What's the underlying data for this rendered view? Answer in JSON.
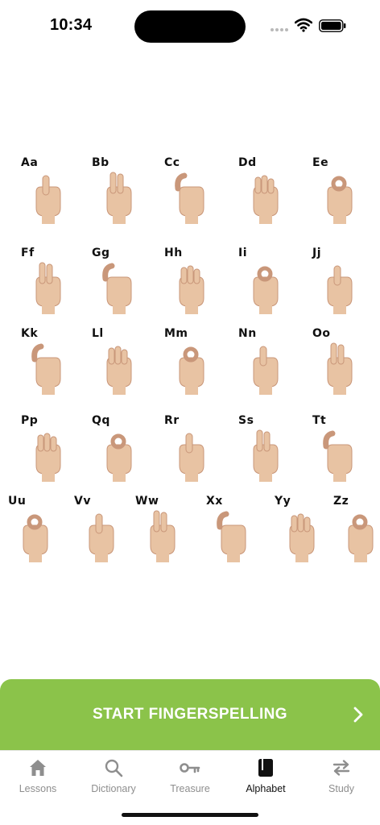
{
  "status_bar": {
    "time": "10:34"
  },
  "alphabet": {
    "rows": [
      {
        "letters": [
          "Aa",
          "Bb",
          "Cc",
          "Dd",
          "Ee"
        ]
      },
      {
        "letters": [
          "Ff",
          "Gg",
          "Hh",
          "Ii",
          "Jj"
        ]
      },
      {
        "letters": [
          "Kk",
          "Ll",
          "Mm",
          "Nn",
          "Oo"
        ]
      },
      {
        "letters": [
          "Pp",
          "Qq",
          "Rr",
          "Ss",
          "Tt"
        ]
      },
      {
        "letters": [
          "Uu",
          "Vv",
          "Ww",
          "Xx",
          "Yy",
          "Zz"
        ]
      }
    ]
  },
  "cta": {
    "label": "START FINGERSPELLING",
    "icon": "chevron-right-icon",
    "color": "#8bc34a"
  },
  "tabs": [
    {
      "label": "Lessons",
      "icon": "home-icon",
      "active": false
    },
    {
      "label": "Dictionary",
      "icon": "search-icon",
      "active": false
    },
    {
      "label": "Treasure",
      "icon": "key-icon",
      "active": false
    },
    {
      "label": "Alphabet",
      "icon": "book-icon",
      "active": true
    },
    {
      "label": "Study",
      "icon": "swap-icon",
      "active": false
    }
  ]
}
